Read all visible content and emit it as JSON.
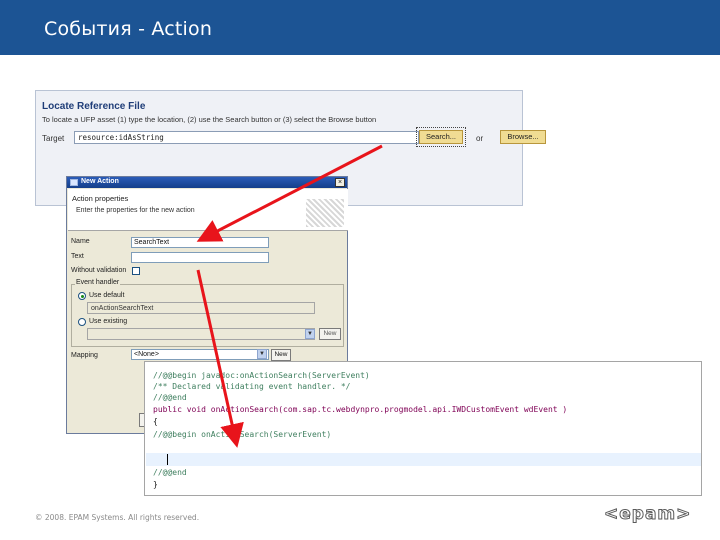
{
  "slide": {
    "title": "События - Action",
    "footer": "© 2008. EPAM Systems. All rights reserved.",
    "logo": "<epam>"
  },
  "locate": {
    "title": "Locate Reference File",
    "hint": "To locate a UFP asset (1) type the location, (2) use the Search button or (3) select the Browse button",
    "target_label": "Target",
    "target_value": "resource:idAsString",
    "search_button": "Search...",
    "or_label": "or",
    "browse_button": "Browse..."
  },
  "dialog": {
    "title": "New Action",
    "banner_title": "Action properties",
    "banner_subtitle": "Enter the properties for the new action",
    "name_label": "Name",
    "name_value": "SearchText",
    "text_label": "Text",
    "text_value": "",
    "without_validation_label": "Without validation",
    "event_handler_label": "Event handler",
    "use_default_label": "Use default",
    "default_value": "onActionSearchText",
    "use_existing_label": "Use existing",
    "new_button": "New",
    "mapping_label": "Mapping",
    "mapping_value": "<None>",
    "new_button_2": "New"
  },
  "code": {
    "lines": [
      "//@@begin javadoc:onActionSearch(ServerEvent)",
      "/** Declared validating event handler. */",
      "//@@end",
      "public void onActionSearch(com.sap.tc.webdynpro.progmodel.api.IWDCustomEvent wdEvent )",
      "{",
      "  //@@begin onActionSearch(ServerEvent)",
      "",
      "",
      "  //@@end",
      "}"
    ]
  },
  "colors": {
    "header": "#1c5494",
    "arrow": "#e8141b",
    "comment": "#3f7f5f",
    "keyword": "#7f0055"
  }
}
